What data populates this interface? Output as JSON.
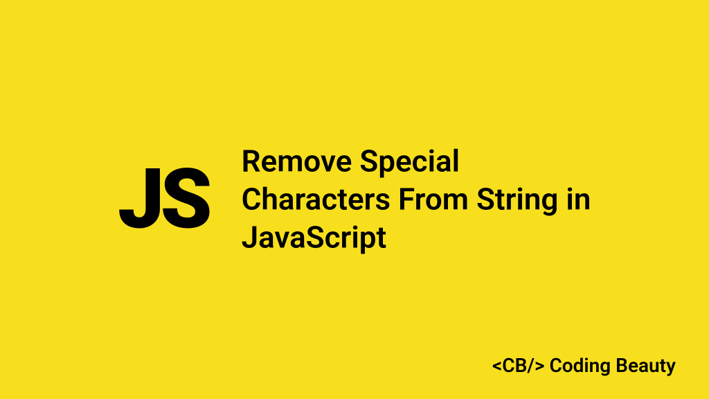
{
  "logo": "JS",
  "title": "Remove Special Characters From String in JavaScript",
  "brand": "<CB/> Coding Beauty"
}
